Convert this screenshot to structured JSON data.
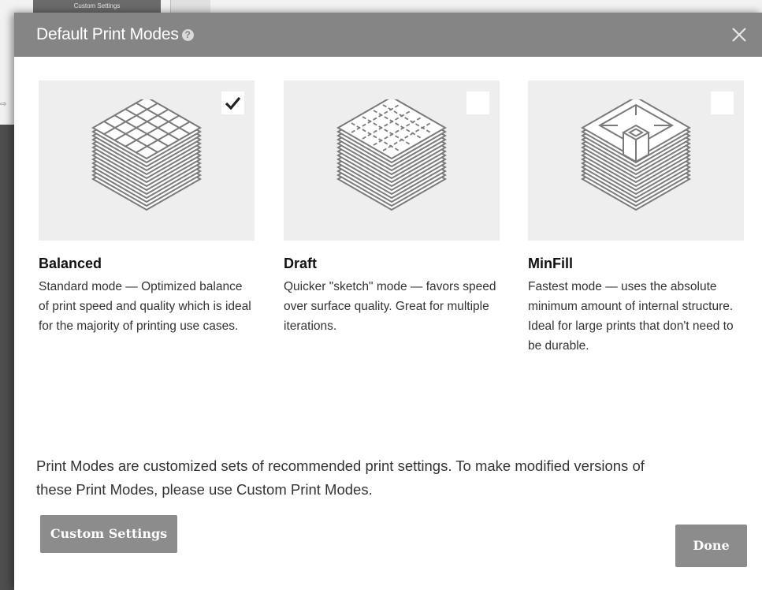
{
  "background": {
    "tab_label": "Custom Settings"
  },
  "dialog": {
    "title": "Default Print Modes",
    "help_icon": "question-circle",
    "close_icon": "close-x"
  },
  "modes": [
    {
      "name": "Balanced",
      "description": "Standard mode — Optimized balance of print speed and quality which is ideal for the majority of printing use cases.",
      "selected": true,
      "illustration": "grid-infill-cube"
    },
    {
      "name": "Draft",
      "description": "Quicker \"sketch\" mode — favors speed over surface quality. Great for multiple iterations.",
      "selected": false,
      "illustration": "dashed-infill-cube"
    },
    {
      "name": "MinFill",
      "description": "Fastest mode — uses the absolute minimum amount of internal structure. Ideal for large prints that don't need to be durable.",
      "selected": false,
      "illustration": "minimal-infill-cube"
    }
  ],
  "footnote": "Print Modes are customized sets of recommended print settings. To make modified versions of these Print Modes, please use Custom Print Modes.",
  "buttons": {
    "custom_settings": "Custom Settings",
    "done": "Done"
  },
  "colors": {
    "header": "#858585",
    "button": "#8c8c8c",
    "card_bg": "#eeeeee",
    "icon_stroke": "#7a7a7a"
  }
}
